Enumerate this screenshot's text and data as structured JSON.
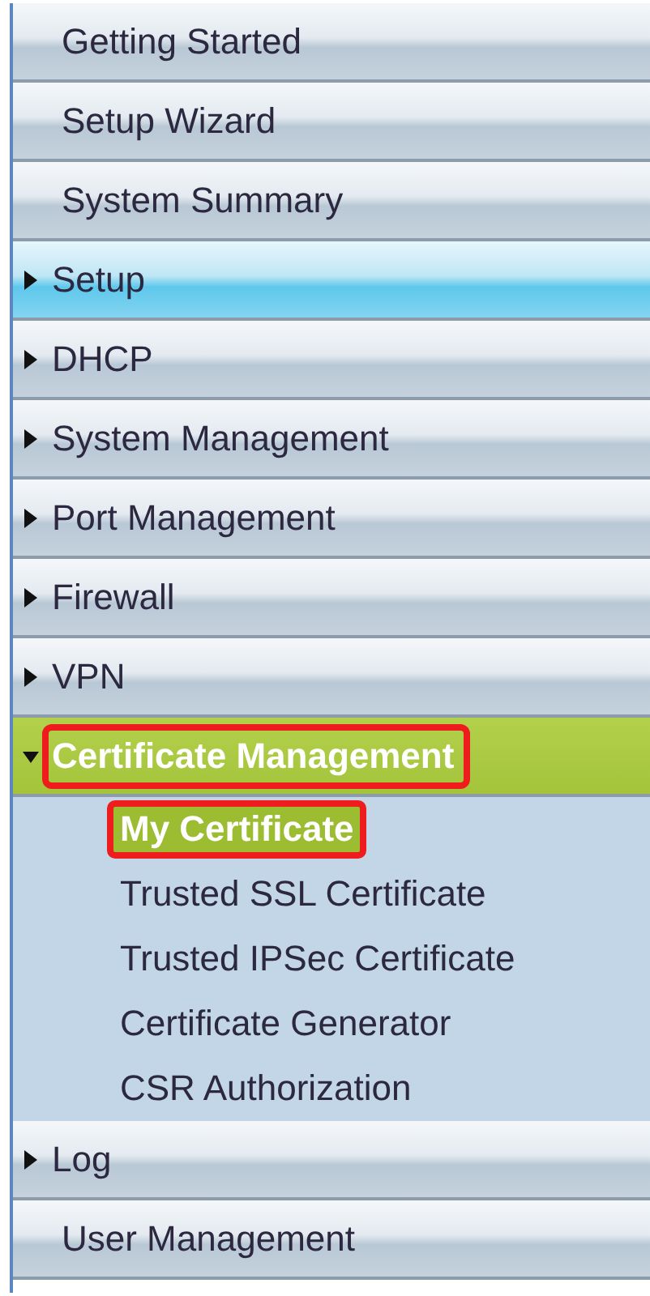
{
  "sidebar": {
    "items": [
      {
        "kind": "link",
        "label": "Getting Started",
        "hovered": false
      },
      {
        "kind": "link",
        "label": "Setup Wizard",
        "hovered": false
      },
      {
        "kind": "link",
        "label": "System Summary",
        "hovered": false
      },
      {
        "kind": "group",
        "label": "Setup",
        "expanded": false,
        "selected": false,
        "hovered": true,
        "highlighted": false
      },
      {
        "kind": "group",
        "label": "DHCP",
        "expanded": false,
        "selected": false,
        "hovered": false,
        "highlighted": false
      },
      {
        "kind": "group",
        "label": "System Management",
        "expanded": false,
        "selected": false,
        "hovered": false,
        "highlighted": false
      },
      {
        "kind": "group",
        "label": "Port Management",
        "expanded": false,
        "selected": false,
        "hovered": false,
        "highlighted": false
      },
      {
        "kind": "group",
        "label": "Firewall",
        "expanded": false,
        "selected": false,
        "hovered": false,
        "highlighted": false
      },
      {
        "kind": "group",
        "label": "VPN",
        "expanded": false,
        "selected": false,
        "hovered": false,
        "highlighted": false
      },
      {
        "kind": "group",
        "label": "Certificate Management",
        "expanded": true,
        "selected": true,
        "hovered": false,
        "highlighted": true,
        "children": [
          {
            "label": "My Certificate",
            "selected": true,
            "highlighted": true
          },
          {
            "label": "Trusted SSL Certificate",
            "selected": false,
            "highlighted": false
          },
          {
            "label": "Trusted IPSec Certificate",
            "selected": false,
            "highlighted": false
          },
          {
            "label": "Certificate Generator",
            "selected": false,
            "highlighted": false
          },
          {
            "label": "CSR Authorization",
            "selected": false,
            "highlighted": false
          }
        ]
      },
      {
        "kind": "group",
        "label": "Log",
        "expanded": false,
        "selected": false,
        "hovered": false,
        "highlighted": false
      },
      {
        "kind": "link",
        "label": "User Management",
        "hovered": false
      }
    ]
  }
}
